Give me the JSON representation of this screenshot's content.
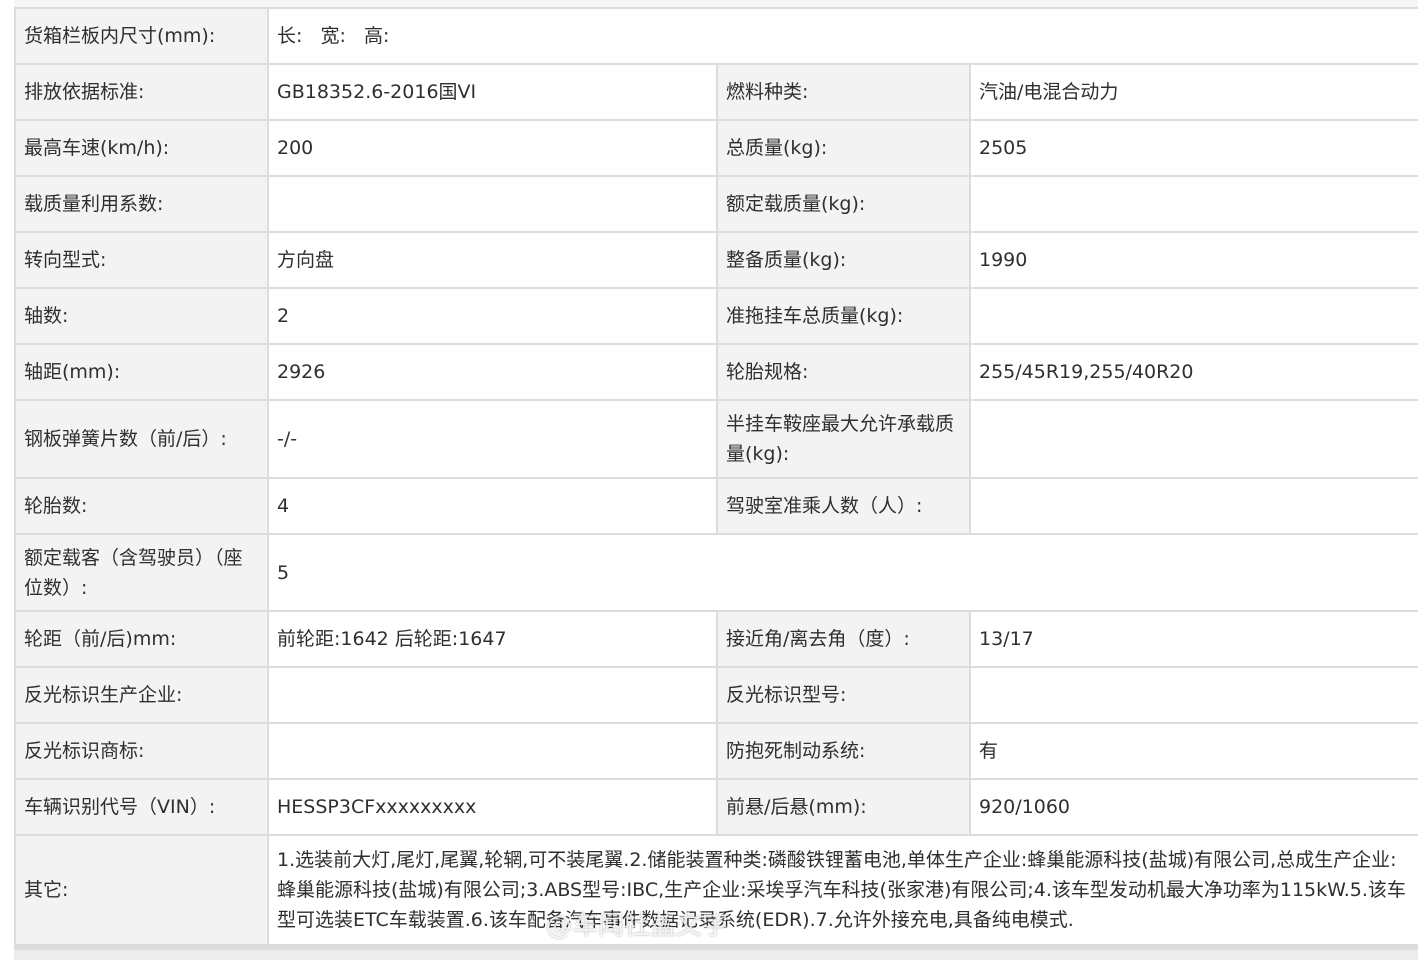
{
  "rows": [
    {
      "l1": "货箱栏板内尺寸(mm):",
      "v1": "长:   宽:   高:"
    },
    {
      "l1": "排放依据标准:",
      "v1": "GB18352.6-2016国VI",
      "l2": "燃料种类:",
      "v2": "汽油/电混合动力"
    },
    {
      "l1": "最高车速(km/h):",
      "v1": "200",
      "l2": "总质量(kg):",
      "v2": "2505"
    },
    {
      "l1": "载质量利用系数:",
      "v1": "",
      "l2": "额定载质量(kg):",
      "v2": ""
    },
    {
      "l1": "转向型式:",
      "v1": "方向盘",
      "l2": "整备质量(kg):",
      "v2": "1990"
    },
    {
      "l1": "轴数:",
      "v1": "2",
      "l2": "准拖挂车总质量(kg):",
      "v2": ""
    },
    {
      "l1": "轴距(mm):",
      "v1": "2926",
      "l2": "轮胎规格:",
      "v2": "255/45R19,255/40R20"
    },
    {
      "l1": "钢板弹簧片数（前/后）:",
      "v1": "-/-",
      "l2": "半挂车鞍座最大允许承载质量(kg):",
      "v2": ""
    },
    {
      "l1": "轮胎数:",
      "v1": "4",
      "l2": "驾驶室准乘人数（人）:",
      "v2": ""
    },
    {
      "l1": "额定载客（含驾驶员）（座位数）:",
      "v1": "5"
    },
    {
      "l1": "轮距（前/后)mm:",
      "v1": "前轮距:1642 后轮距:1647",
      "l2": "接近角/离去角（度）:",
      "v2": "13/17"
    },
    {
      "l1": "反光标识生产企业:",
      "v1": "",
      "l2": "反光标识型号:",
      "v2": ""
    },
    {
      "l1": "反光标识商标:",
      "v1": "",
      "l2": "防抱死制动系统:",
      "v2": "有"
    },
    {
      "l1": "车辆识别代号（VIN）:",
      "v1": "HESSP3CFxxxxxxxxx",
      "l2": "前悬/后悬(mm):",
      "v2": "920/1060"
    },
    {
      "l1": "其它:",
      "v1": "1.选装前大灯,尾灯,尾翼,轮辋,可不装尾翼.2.储能装置种类:磷酸铁锂蓄电池,单体生产企业:蜂巢能源科技(盐城)有限公司,总成生产企业:蜂巢能源科技(盐城)有限公司;3.ABS型号:IBC,生产企业:采埃孚汽车科技(张家港)有限公司;4.该车型发动机最大净功率为115kW.5.该车型可选装ETC车载装置.6.该车配备汽车事件数据记录系统(EDR).7.允许外接充电,具备纯电模式."
    }
  ],
  "watermark": "@车闻社盖文宇"
}
